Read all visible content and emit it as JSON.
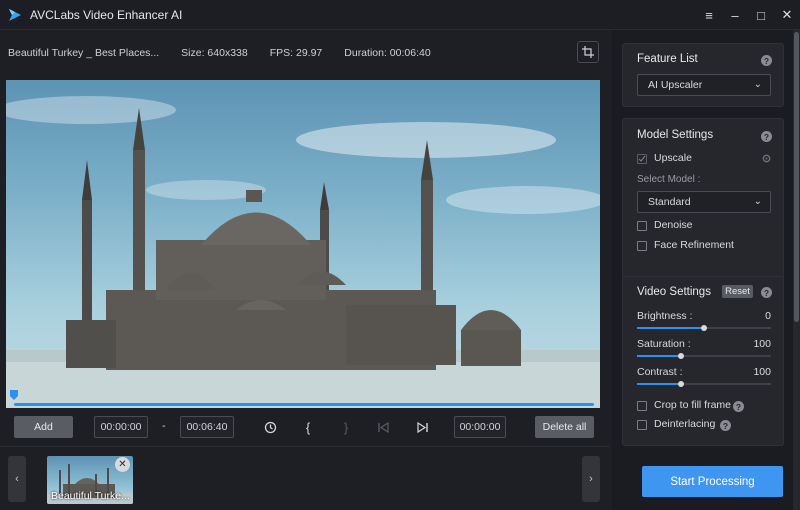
{
  "app": {
    "title": "AVCLabs Video Enhancer AI",
    "window_controls": [
      "menu-icon",
      "minimize-icon",
      "maximize-icon",
      "close-icon"
    ]
  },
  "info": {
    "filename": "Beautiful Turkey _ Best Places...",
    "size": "Size: 640x338",
    "fps": "FPS: 29.97",
    "duration": "Duration: 00:06:40"
  },
  "timeline": {
    "progress": 1.0
  },
  "controls": {
    "add_label": "Add",
    "start_time": "00:00:00",
    "separator": "-",
    "end_time": "00:06:40",
    "current_time": "00:00:00",
    "delete_all_label": "Delete all",
    "icons": [
      "history-icon",
      "mark-in-icon",
      "mark-out-icon",
      "skip-previous-icon",
      "skip-next-icon"
    ]
  },
  "thumbnails": [
    {
      "label": "Beautiful Turke..."
    }
  ],
  "sidebar": {
    "feature_list": {
      "title": "Feature List",
      "selected": "AI Upscaler"
    },
    "model_settings": {
      "title": "Model Settings",
      "upscale_label": "Upscale",
      "upscale_checked": true,
      "select_model_label": "Select Model :",
      "model_selected": "Standard",
      "denoise_label": "Denoise",
      "denoise_checked": false,
      "face_label": "Face Refinement",
      "face_checked": false
    },
    "video_settings": {
      "title": "Video Settings",
      "reset_label": "Reset",
      "brightness_label": "Brightness :",
      "brightness_value": "0",
      "brightness_fraction": 0.5,
      "saturation_label": "Saturation :",
      "saturation_value": "100",
      "saturation_fraction": 0.33,
      "contrast_label": "Contrast :",
      "contrast_value": "100",
      "contrast_fraction": 0.33,
      "crop_label": "Crop to fill frame",
      "crop_checked": false,
      "deinterlace_label": "Deinterlacing",
      "deinterlace_checked": false
    },
    "start_label": "Start Processing"
  },
  "colors": {
    "accent": "#3f96f1",
    "background": "#1e1f24",
    "panel": "#26272d"
  }
}
